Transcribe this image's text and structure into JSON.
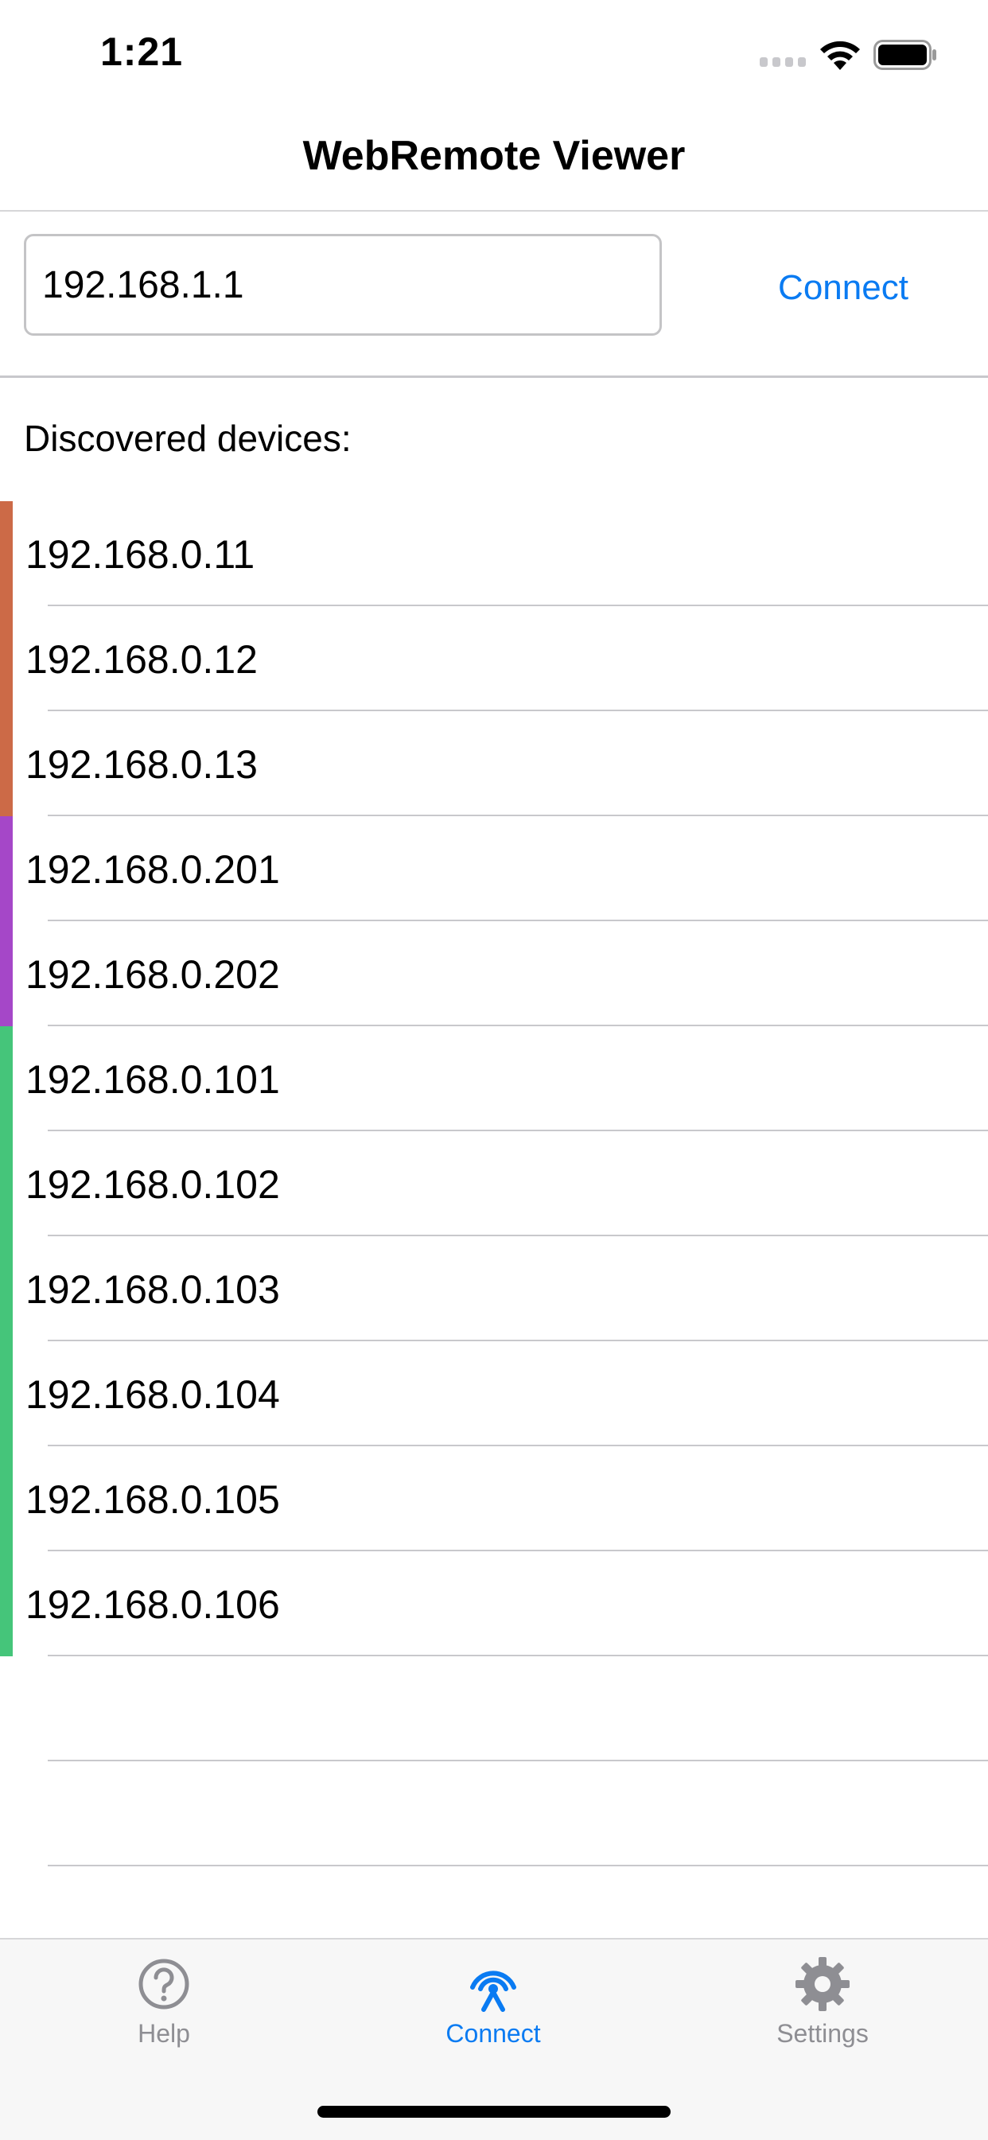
{
  "status_bar": {
    "time": "1:21"
  },
  "nav": {
    "title": "WebRemote Viewer"
  },
  "connect": {
    "ip_value": "192.168.1.1",
    "button_label": "Connect",
    "accent_color": "#0a7bf2"
  },
  "discovered": {
    "label": "Discovered devices:",
    "devices": [
      {
        "ip": "192.168.0.11",
        "group_color": "#cc6a47"
      },
      {
        "ip": "192.168.0.12",
        "group_color": "#cc6a47"
      },
      {
        "ip": "192.168.0.13",
        "group_color": "#cc6a47"
      },
      {
        "ip": "192.168.0.201",
        "group_color": "#a547c8"
      },
      {
        "ip": "192.168.0.202",
        "group_color": "#a547c8"
      },
      {
        "ip": "192.168.0.101",
        "group_color": "#45c57a"
      },
      {
        "ip": "192.168.0.102",
        "group_color": "#45c57a"
      },
      {
        "ip": "192.168.0.103",
        "group_color": "#45c57a"
      },
      {
        "ip": "192.168.0.104",
        "group_color": "#45c57a"
      },
      {
        "ip": "192.168.0.105",
        "group_color": "#45c57a"
      },
      {
        "ip": "192.168.0.106",
        "group_color": "#45c57a"
      }
    ]
  },
  "tab_bar": {
    "tabs": [
      {
        "label": "Help",
        "icon": "help-icon",
        "active": false
      },
      {
        "label": "Connect",
        "icon": "antenna-icon",
        "active": true
      },
      {
        "label": "Settings",
        "icon": "gear-icon",
        "active": false
      }
    ]
  }
}
